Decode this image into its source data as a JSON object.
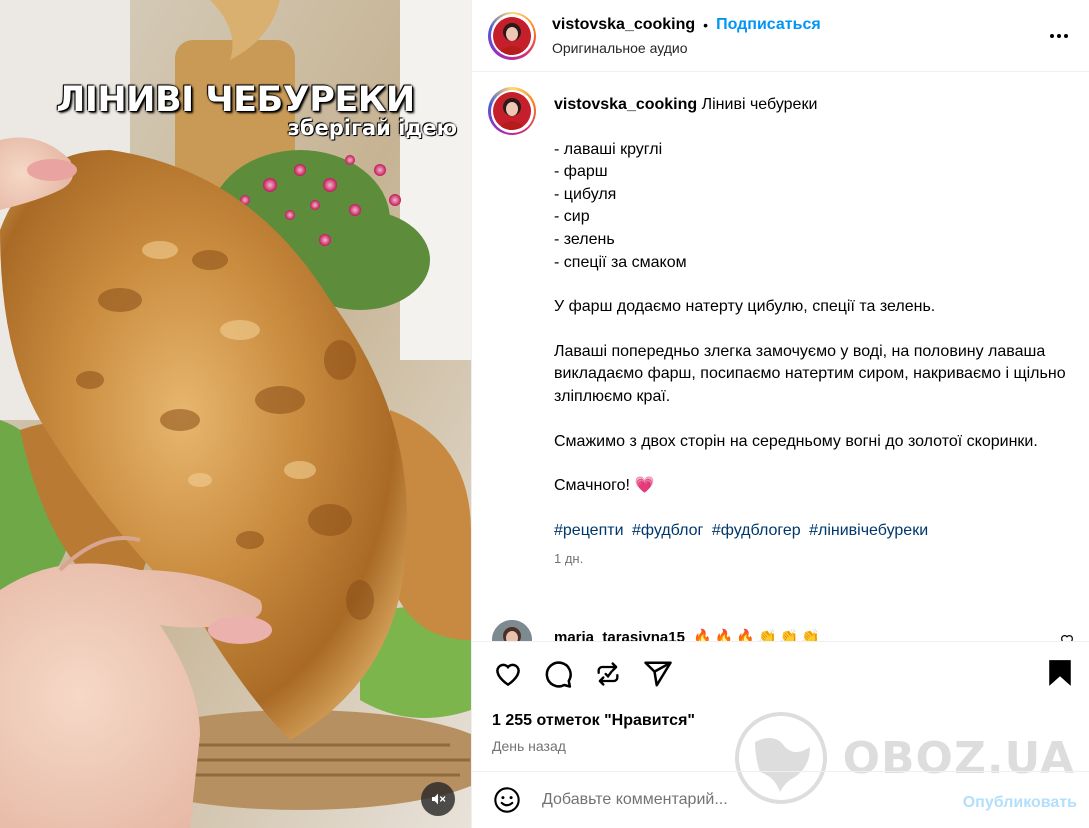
{
  "media": {
    "overlay_title": "ЛІНИВІ ЧЕБУРЕКИ",
    "overlay_subtitle": "зберігай ідею",
    "mute_icon": "speaker-muted-icon"
  },
  "header": {
    "username": "vistovska_cooking",
    "separator": "•",
    "follow_label": "Подписаться",
    "audio_label": "Оригинальное аудио",
    "more_icon": "more-options-icon"
  },
  "caption": {
    "username": "vistovska_cooking",
    "title": "Ліниві чебуреки",
    "ingredients": [
      "- лаваші круглі",
      "- фарш",
      "- цибуля",
      "- сир",
      "- зелень",
      "- спеції за смаком"
    ],
    "step1": "У фарш додаємо натерту цибулю, спеції та зелень.",
    "step2": "Лаваші попередньо злегка замочуємо у воді, на половину лаваша викладаємо фарш, посипаємо натертим сиром, накриваємо і щільно зліплюємо краї.",
    "step3": "Смажимо з двох сторін на середньому вогні до золотої скоринки.",
    "closing": "Смачного!",
    "closing_emoji": "💗",
    "hashtags": [
      "#рецепти",
      "#фудблог",
      "#фудблогер",
      "#лінивічебуреки"
    ],
    "time": "1 дн."
  },
  "comment": {
    "username": "maria_tarasivna15",
    "text": "🔥🔥🔥👏👏👏"
  },
  "actions": {
    "icons": [
      "heart-icon",
      "comment-icon",
      "share-repost-icon",
      "send-icon",
      "bookmark-icon"
    ],
    "likes": "1 255 отметок \"Нравится\"",
    "posted": "День назад"
  },
  "add_comment": {
    "placeholder": "Добавьте комментарий...",
    "publish_label": "Опубликовать"
  },
  "watermark": {
    "text": "OBOZ.UA"
  },
  "colors": {
    "accent": "#0095f6",
    "hashtag": "#00376b",
    "muted": "#737373",
    "publish_disabled": "#b2dffc"
  }
}
